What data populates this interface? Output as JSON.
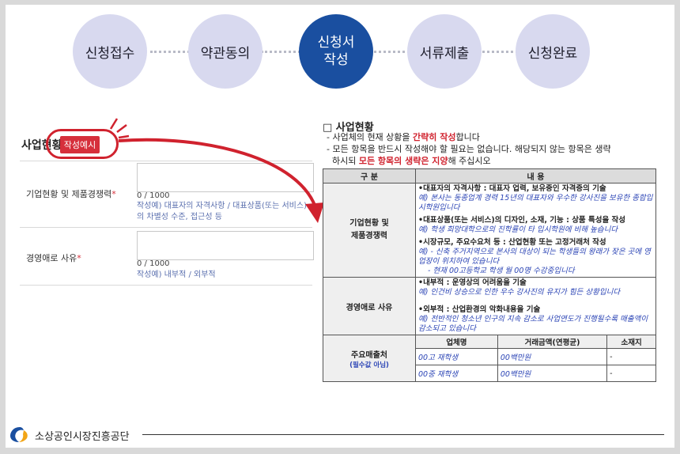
{
  "steps": [
    {
      "label": "신청접수",
      "active": false
    },
    {
      "label": "약관동의",
      "active": false
    },
    {
      "label": "신청서\n작성",
      "active": true
    },
    {
      "label": "서류제출",
      "active": false
    },
    {
      "label": "신청완료",
      "active": false
    }
  ],
  "left_form": {
    "title": "사업현황",
    "example_button": "작성예시",
    "fields": [
      {
        "label": "기업현황 및 제품경쟁력",
        "required_mark": "*",
        "counter": "0 / 1000",
        "hint": "작성예) 대표자의 자격사항 / 대표상품(또는 서비스)의 차별성 수준, 접근성 등"
      },
      {
        "label": "경영애로 사유",
        "required_mark": "*",
        "counter": "0 / 1000",
        "hint": "작성예) 내부적 / 외부적"
      }
    ]
  },
  "right_doc": {
    "title": "□ 사업현황",
    "bullets": [
      {
        "pre": "- 사업체의 현재 상황을 ",
        "emph": "간략히 작성",
        "post": "합니다"
      },
      {
        "pre": "- 모든 항목을 반드시 작성해야 할 필요는 없습니다. 해당되지 않는 항목은 생략",
        "emph": "",
        "post": ""
      },
      {
        "pre": "  하시되 ",
        "emph": "모든 항목의 생략은 지양",
        "post": "해 주십시오"
      }
    ],
    "table": {
      "headers": [
        "구 분",
        "내 용"
      ],
      "row1": {
        "category": "기업현황 및\n제품경쟁력",
        "items": [
          {
            "item": "•대표자의 자격사항 : 대표자 업력, 보유중인 자격증의 기술",
            "ex": "예) 본사는 동종업계 경력 15년의 대표자와 우수한 강사진을 보유한 종합입시학원입니다"
          },
          {
            "item": "•대표상품(또는 서비스)의 디자인, 소재, 기능 : 상품 특성을 작성",
            "ex": "예) 학생 희망대학으로의 진학률이 타 입시학원에 비해 높습니다"
          },
          {
            "item": "•시장규모, 주요수요처 등 : 산업현황 또는 고정거래처 작성",
            "ex": "예) - 신축 주거지역으로 본사의 대상이 되는 학생들의 왕래가 잦은 곳에 영업장이 위치하여 있습니다",
            "ex2": "- 현재 00고등학교 학생 월 00명 수강중입니다"
          }
        ]
      },
      "row2": {
        "category": "경영애로 사유",
        "items": [
          {
            "item": "•내부적 : 운영상의 어려움을 기술",
            "ex": "예) 인건비 상승으로 인한 우수 강사진의 유지가 힘든 상황입니다"
          },
          {
            "item": "•외부적 : 산업환경의 악화내용을 기술",
            "ex": "예) 전반적인 청소년 인구의 지속 감소로 사업연도가 진행될수록 매출액이 감소되고 있습니다"
          }
        ]
      },
      "row3": {
        "category": "주요매출처",
        "note": "(필수값 아님)",
        "sub_headers": [
          "업체명",
          "거래금액(연평균)",
          "소재지"
        ],
        "rows": [
          [
            "00고 재학생",
            "00백만원",
            "-"
          ],
          [
            "00중 재학생",
            "00백만원",
            "-"
          ]
        ]
      }
    }
  },
  "footer": {
    "org_name": "소상공인시장진흥공단"
  },
  "colors": {
    "step_inactive": "#d8d9ef",
    "step_active": "#1a4fa0",
    "accent_red": "#d62f3b",
    "example_blue": "#2b44b5"
  }
}
